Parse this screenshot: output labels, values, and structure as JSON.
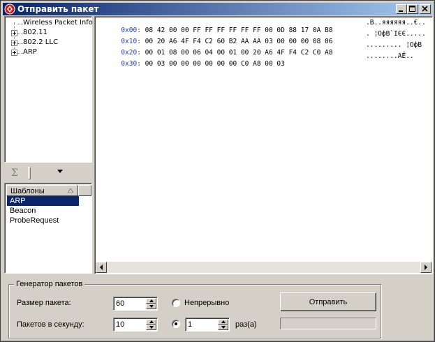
{
  "window": {
    "title": "Отправить пакет"
  },
  "tree": {
    "items": [
      {
        "label": "Wireless Packet Info",
        "expandable": false
      },
      {
        "label": "802.11",
        "expandable": true
      },
      {
        "label": "802.2 LLC",
        "expandable": true
      },
      {
        "label": "ARP",
        "expandable": true
      }
    ]
  },
  "hex": {
    "rows": [
      {
        "offset": "0x00:",
        "bytes": "08 42 00 00 FF FF FF FF FF FF 00 0D 88 17 0A B8",
        "ascii": ".B..яяяяяя..€.."
      },
      {
        "offset": "0x10:",
        "bytes": "00 20 A6 4F F4 C2 60 B2 AA AA 03 00 00 00 08 06",
        "ascii": ". ¦OфВ`ІЄЄ....."
      },
      {
        "offset": "0x20:",
        "bytes": "00 01 08 00 06 04 00 01 00 20 A6 4F F4 C2 C0 A8",
        "ascii": "......... ¦OфВ"
      },
      {
        "offset": "0x30:",
        "bytes": "00 03 00 00 00 00 00 00 C0 A8 00 03",
        "ascii": "........АЁ.."
      }
    ]
  },
  "toolbar": {
    "sigma": "Σ"
  },
  "templates": {
    "header": "Шаблоны",
    "items": [
      "ARP",
      "Beacon",
      "ProbeRequest"
    ],
    "selected_index": 0
  },
  "generator": {
    "title": "Генератор пакетов",
    "size_label": "Размер пакета:",
    "size_value": "60",
    "rate_label": "Пакетов в секунду:",
    "rate_value": "10",
    "continuous_label": "Непрерывно",
    "count_value": "1",
    "count_suffix": "раз(а)",
    "send_label": "Отправить",
    "mode": "count"
  },
  "colors": {
    "title_start": "#0a246a",
    "title_end": "#a6caf0",
    "offset": "#1c3fd0",
    "selection": "#0a246a"
  }
}
